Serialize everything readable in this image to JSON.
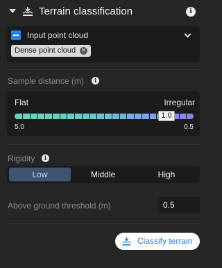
{
  "header": {
    "title": "Terrain classification"
  },
  "input": {
    "label": "Input point cloud",
    "selected_chip": "Dense point cloud"
  },
  "sample_distance": {
    "label": "Sample distance (m)",
    "left_label": "Flat",
    "right_label": "Irregular",
    "value": "1.0",
    "min_label": "5.0",
    "max_label": "0.5"
  },
  "rigidity": {
    "label": "Rigidity",
    "options": [
      "Low",
      "Middle",
      "High"
    ],
    "selected": "Low"
  },
  "threshold": {
    "label": "Above ground threshold (m)",
    "value": "0.5"
  },
  "action": {
    "classify_label": "Classify terrain"
  },
  "colors": {
    "accent": "#1e88e5",
    "button_text": "#1f7fd8",
    "segment_active": "#3d5573"
  },
  "icons": {
    "header": "terrain-icon",
    "info": "info-icon",
    "chevron": "chevron-down-icon",
    "chip_remove": "close-circle-icon"
  }
}
